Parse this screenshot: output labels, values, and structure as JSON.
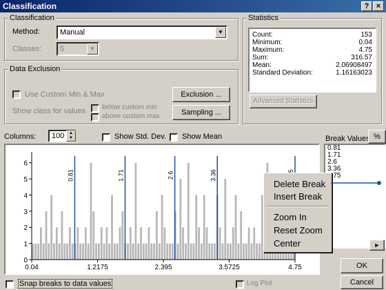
{
  "window": {
    "title": "Classification",
    "help_btn": "?",
    "close_btn": "×"
  },
  "classification": {
    "group_label": "Classification",
    "method_label": "Method:",
    "method_value": "Manual",
    "classes_label": "Classes:",
    "classes_value": "5"
  },
  "data_exclusion": {
    "group_label": "Data Exclusion",
    "use_custom_label": "Use Custom Min & Max",
    "show_class_label": "Show class for values",
    "below_custom_label": "below custom min",
    "above_custom_label": "above custom max",
    "exclusion_btn": "Exclusion ...",
    "sampling_btn": "Sampling ..."
  },
  "statistics": {
    "group_label": "Statistics",
    "rows": [
      {
        "label": "Count:",
        "value": "153"
      },
      {
        "label": "Minimum:",
        "value": "0.04"
      },
      {
        "label": "Maximum:",
        "value": "4.75"
      },
      {
        "label": "Sum:",
        "value": "316.57"
      },
      {
        "label": "Mean:",
        "value": "2.06908497"
      },
      {
        "label": "Standard Deviation:",
        "value": "1.16163023"
      }
    ],
    "advanced_btn": "Advanced Statistics"
  },
  "options": {
    "columns_label": "Columns:",
    "columns_value": "100",
    "show_std_dev": "Show Std. Dev.",
    "show_mean": "Show Mean"
  },
  "break_values": {
    "label": "Break Values",
    "percent_btn": "%",
    "values": [
      "0.81",
      "1.71",
      "2.6",
      "3.36",
      "4.75"
    ]
  },
  "context_menu": {
    "delete_break": "Delete Break",
    "insert_break": "Insert Break",
    "zoom_in": "Zoom In",
    "reset_zoom": "Reset Zoom",
    "center": "Center"
  },
  "bottom": {
    "snap_label": "Snap breaks to data values",
    "log_plot_label": "Log Plot",
    "ok_btn": "OK",
    "cancel_btn": "Cancel"
  },
  "chart_data": {
    "type": "bar",
    "x_range": [
      0.04,
      4.75
    ],
    "ylim": [
      0,
      6.5
    ],
    "y_ticks": [
      "0",
      "1",
      "2",
      "3",
      "4",
      "5",
      "6"
    ],
    "x_ticks": [
      "0.04",
      "1.2175",
      "2.395",
      "3.5725",
      "4.75"
    ],
    "x_tick_values": [
      0.04,
      1.2175,
      2.395,
      3.5725,
      4.75
    ],
    "bins": [
      1,
      1,
      1,
      2,
      1,
      3,
      1,
      4,
      1,
      2,
      1,
      3,
      1,
      1,
      2,
      1,
      1,
      2,
      1,
      1,
      2,
      1,
      6,
      3,
      1,
      1,
      2,
      1,
      2,
      1,
      4,
      1,
      1,
      2,
      3,
      1,
      1,
      2,
      1,
      6,
      1,
      2,
      1,
      1,
      2,
      1,
      1,
      3,
      1,
      4,
      2,
      1,
      1,
      1,
      3,
      1,
      5,
      2,
      1,
      6,
      1,
      1,
      4,
      2,
      1,
      4,
      2,
      1,
      1,
      1,
      4,
      2,
      1,
      5,
      1,
      1,
      2,
      4,
      1,
      3,
      1,
      1,
      2,
      1,
      2,
      1,
      1,
      4,
      1,
      6,
      1,
      1,
      2,
      1,
      1,
      1,
      1,
      2,
      1,
      1
    ],
    "breaks": [
      0.81,
      1.71,
      2.6,
      3.36,
      4.75
    ],
    "break_labels": [
      "0.81",
      "1.71",
      "2.6",
      "3.36",
      "4.75"
    ]
  }
}
